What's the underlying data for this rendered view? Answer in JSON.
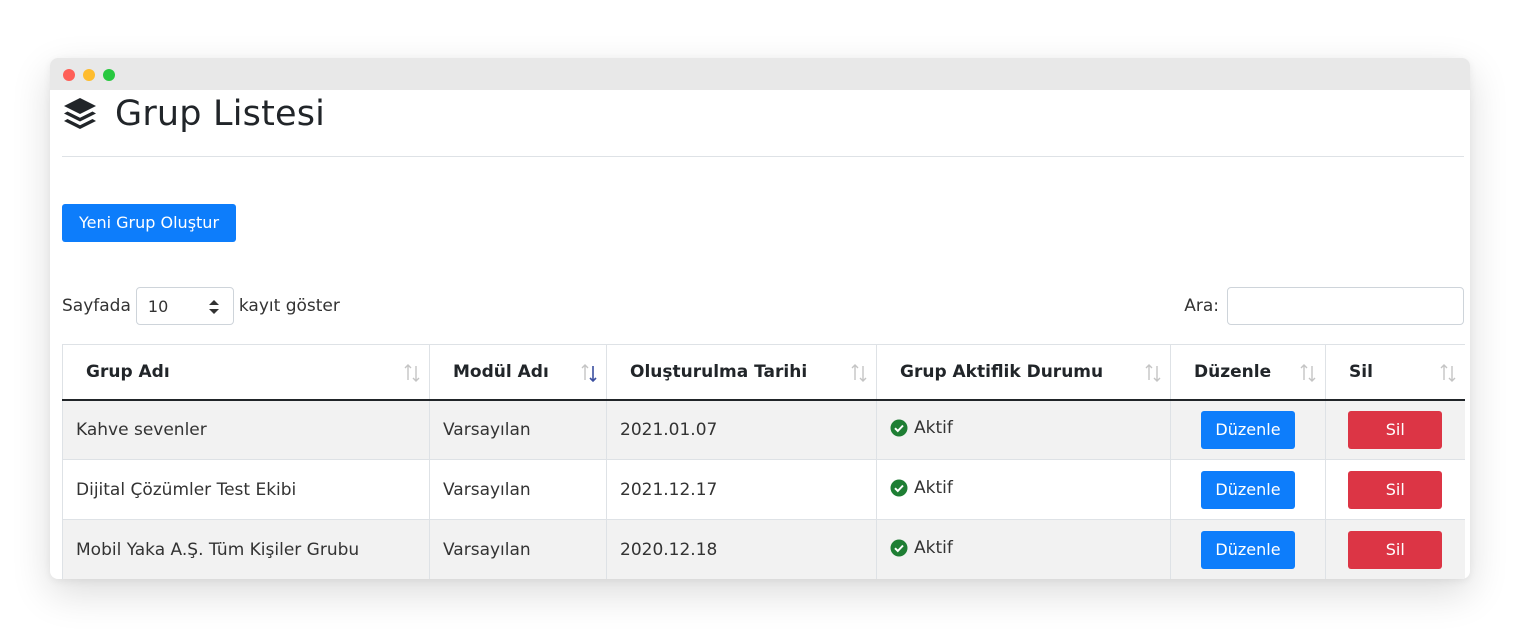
{
  "page": {
    "title": "Grup Listesi",
    "new_button_label": "Yeni Grup Oluştur"
  },
  "length_control": {
    "prefix": "Sayfada",
    "selected_value": "10",
    "suffix": "kayıt göster"
  },
  "search": {
    "label": "Ara:",
    "value": ""
  },
  "table": {
    "columns": [
      {
        "label": "Grup Adı",
        "sort": "none"
      },
      {
        "label": "Modül Adı",
        "sort": "descending"
      },
      {
        "label": "Oluşturulma Tarihi",
        "sort": "none"
      },
      {
        "label": "Grup Aktiflik Durumu",
        "sort": "none"
      },
      {
        "label": "Düzenle",
        "sort": "none"
      },
      {
        "label": "Sil",
        "sort": "none"
      }
    ],
    "rows": [
      {
        "group_name": "Kahve sevenler",
        "module": "Varsayılan",
        "created": "2021.01.07",
        "status": "Aktif",
        "edit_label": "Düzenle",
        "delete_label": "Sil"
      },
      {
        "group_name": "Dijital Çözümler Test Ekibi",
        "module": "Varsayılan",
        "created": "2021.12.17",
        "status": "Aktif",
        "edit_label": "Düzenle",
        "delete_label": "Sil"
      },
      {
        "group_name": "Mobil Yaka A.Ş. Tüm Kişiler Grubu",
        "module": "Varsayılan",
        "created": "2020.12.18",
        "status": "Aktif",
        "edit_label": "Düzenle",
        "delete_label": "Sil"
      }
    ]
  },
  "colors": {
    "primary": "#0d7dfb",
    "danger": "#dc3545",
    "success": "#1e7e34",
    "sort_active": "#3b4fa0"
  },
  "icons": {
    "header": "layers-icon",
    "status": "check-circle-icon",
    "sort": "sort-arrows-icon",
    "select": "select-arrows-icon"
  }
}
